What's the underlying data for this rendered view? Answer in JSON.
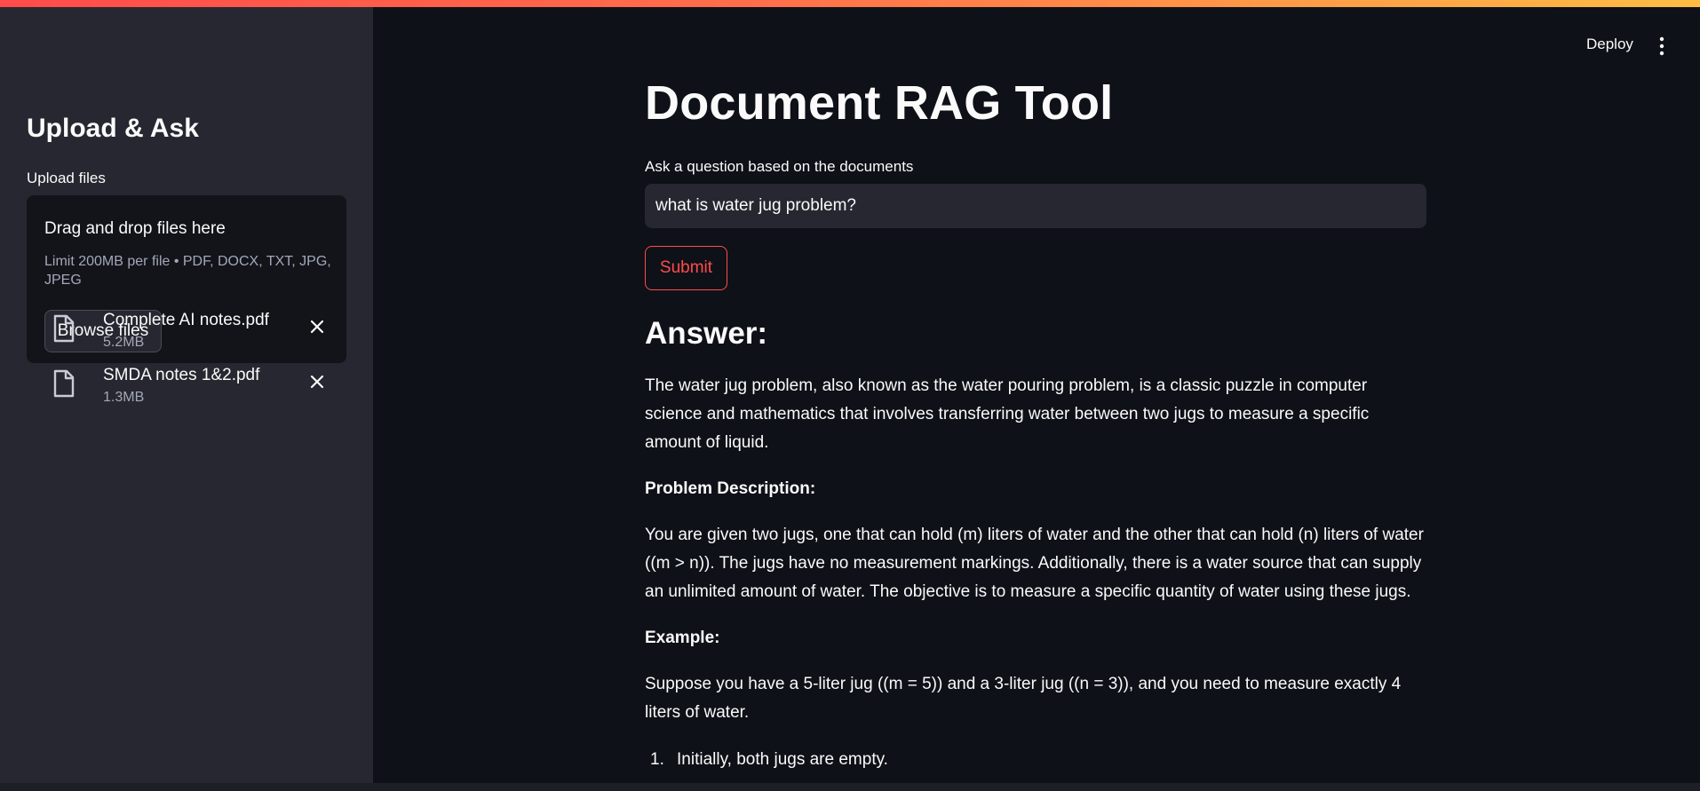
{
  "header": {
    "deploy_label": "Deploy",
    "menu_icon": "kebab-menu-icon"
  },
  "sidebar": {
    "title": "Upload & Ask",
    "upload_label": "Upload files",
    "dropzone": {
      "title": "Drag and drop files here",
      "limit": "Limit 200MB per file • PDF, DOCX, TXT, JPG, JPEG",
      "browse_label": "Browse files"
    },
    "files": [
      {
        "name": "Complete AI notes.pdf",
        "size": "5.2MB"
      },
      {
        "name": "SMDA notes 1&2.pdf",
        "size": "1.3MB"
      }
    ]
  },
  "main": {
    "title": "Document RAG Tool",
    "question_label": "Ask a question based on the documents",
    "question_value": "what is water jug problem?",
    "submit_label": "Submit",
    "answer_heading": "Answer:",
    "answer": {
      "intro": "The water jug problem, also known as the water pouring problem, is a classic puzzle in computer science and mathematics that involves transferring water between two jugs to measure a specific amount of liquid.",
      "problem_heading": "Problem Description:",
      "problem_text": "You are given two jugs, one that can hold (m) liters of water and the other that can hold (n) liters of water ((m > n)). The jugs have no measurement markings. Additionally, there is a water source that can supply an unlimited amount of water. The objective is to measure a specific quantity of water using these jugs.",
      "example_heading": "Example:",
      "example_text": "Suppose you have a 5-liter jug ((m = 5)) and a 3-liter jug ((n = 3)), and you need to measure exactly 4 liters of water.",
      "steps": [
        {
          "num": "1.",
          "text": "Initially, both jugs are empty."
        }
      ]
    }
  },
  "colors": {
    "background": "#0e1117",
    "sidebar": "#262730",
    "accent": "#ff4b4b",
    "text": "#fafafa",
    "muted": "#a3a8b8"
  }
}
